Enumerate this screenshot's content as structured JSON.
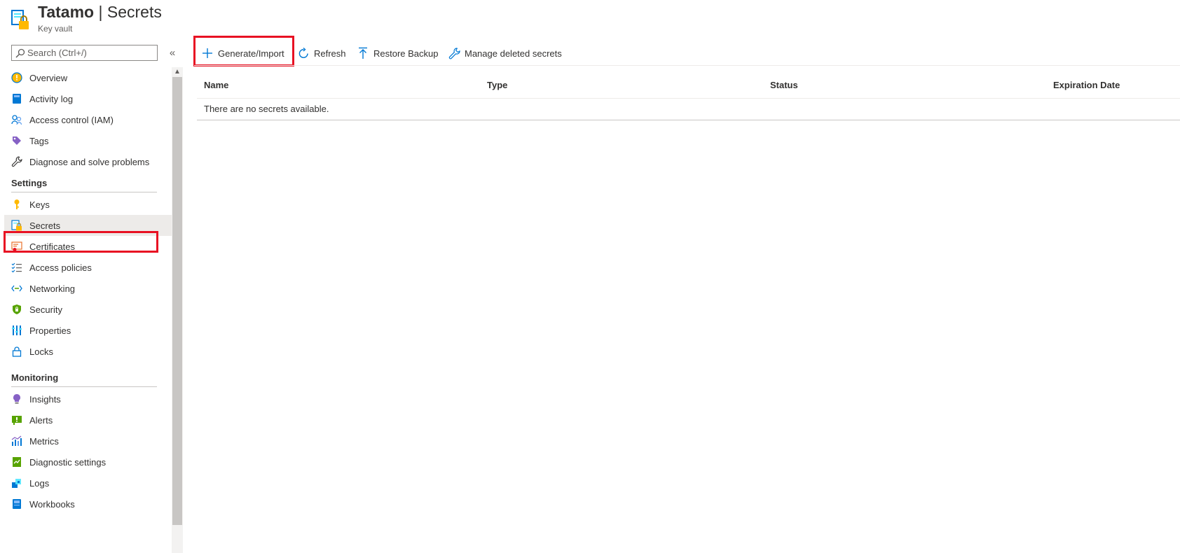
{
  "header": {
    "resource_name": "Tatamo",
    "separator": "|",
    "page_name": "Secrets",
    "subtitle": "Key vault"
  },
  "search": {
    "placeholder": "Search (Ctrl+/)"
  },
  "collapse_label": "«",
  "nav": {
    "items_top": [
      {
        "label": "Overview",
        "icon": "overview-icon"
      },
      {
        "label": "Activity log",
        "icon": "activity-log-icon"
      },
      {
        "label": "Access control (IAM)",
        "icon": "iam-icon"
      },
      {
        "label": "Tags",
        "icon": "tag-icon"
      },
      {
        "label": "Diagnose and solve problems",
        "icon": "wrench-icon"
      }
    ],
    "settings": {
      "title": "Settings",
      "items": [
        {
          "label": "Keys",
          "icon": "key-icon"
        },
        {
          "label": "Secrets",
          "icon": "secret-icon",
          "selected": true
        },
        {
          "label": "Certificates",
          "icon": "certificate-icon"
        },
        {
          "label": "Access policies",
          "icon": "access-policies-icon"
        },
        {
          "label": "Networking",
          "icon": "networking-icon"
        },
        {
          "label": "Security",
          "icon": "shield-icon"
        },
        {
          "label": "Properties",
          "icon": "properties-icon"
        },
        {
          "label": "Locks",
          "icon": "lock-icon"
        }
      ]
    },
    "monitoring": {
      "title": "Monitoring",
      "items": [
        {
          "label": "Insights",
          "icon": "insights-icon"
        },
        {
          "label": "Alerts",
          "icon": "alerts-icon"
        },
        {
          "label": "Metrics",
          "icon": "metrics-icon"
        },
        {
          "label": "Diagnostic settings",
          "icon": "diagnostic-settings-icon"
        },
        {
          "label": "Logs",
          "icon": "logs-icon"
        },
        {
          "label": "Workbooks",
          "icon": "workbooks-icon"
        }
      ]
    }
  },
  "toolbar": {
    "generate_import": "Generate/Import",
    "refresh": "Refresh",
    "restore_backup": "Restore Backup",
    "manage_deleted": "Manage deleted secrets"
  },
  "table": {
    "columns": [
      "Name",
      "Type",
      "Status",
      "Expiration Date"
    ],
    "empty_message": "There are no secrets available."
  },
  "colors": {
    "highlight": "#e81123",
    "accent": "#0078d4",
    "selected_bg": "#edebe9"
  }
}
